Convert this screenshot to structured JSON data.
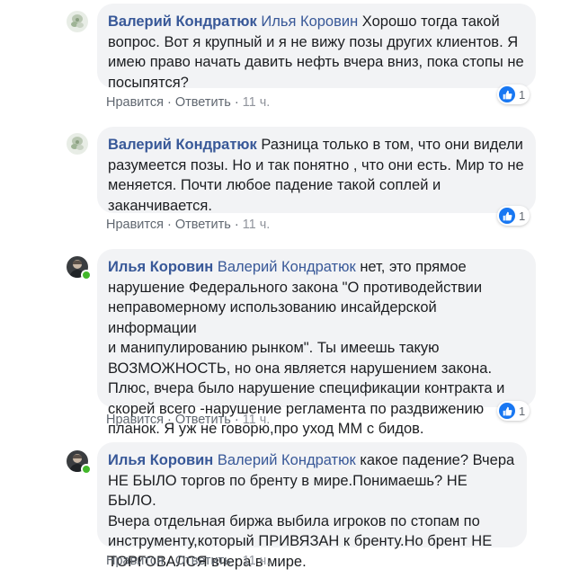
{
  "colors": {
    "link": "#385898",
    "bubble_bg": "#f2f3f5",
    "like_blue": "#1877f2",
    "online_green": "#42b72a",
    "meta_gray": "#606770"
  },
  "comments": [
    {
      "avatar_icon": "flower-avatar-icon",
      "author": "Валерий Кондратюк",
      "mention": "Илья Коровин",
      "text_lines": [
        "Хорошо тогда такой",
        "вопрос. Вот я крупный и я не вижу позы других клиентов. Я",
        "имею право начать давить нефть вчера вниз, пока стопы не",
        "посыпятся?"
      ],
      "reactions": "1",
      "like": "Нравится",
      "reply": "Ответить",
      "time": "11 ч."
    },
    {
      "avatar_icon": "flower-avatar-icon",
      "author": "Валерий Кондратюк",
      "mention": "",
      "text_lines": [
        "Разница только в том, что они видели",
        "разумеется позы. Но и так понятно , что они есть. Мир то не",
        "меняется. Почти любое падение такой соплей и",
        "заканчивается."
      ],
      "reactions": "1",
      "like": "Нравится",
      "reply": "Ответить",
      "time": "11 ч."
    },
    {
      "avatar_icon": "person-avatar-icon",
      "author": "Илья Коровин",
      "mention": "Валерий Кондратюк",
      "text_lines": [
        "нет, это прямое",
        "нарушение Федерального закона \"О противодействии",
        "неправомерному использованию инсайдерской информации",
        "и манипулированию рынком\". Ты имеешь такую",
        "ВОЗМОЖНОСТЬ, но она является нарушением закона.",
        "Плюс, вчера было нарушение спецификации контракта и",
        "скорей всего -нарушение регламента по раздвижению",
        "планок. Я уж не говорю,про уход ММ с бидов."
      ],
      "reactions": "1",
      "like": "Нравится",
      "reply": "Ответить",
      "time": "11 ч."
    },
    {
      "avatar_icon": "person-avatar-icon",
      "author": "Илья Коровин",
      "mention": "Валерий Кондратюк",
      "text_lines": [
        "какое падение? Вчера",
        "НЕ БЫЛО торгов по бренту в мире.Понимаешь? НЕ БЫЛО.",
        "Вчера отдельная биржа выбила игроков по стопам по",
        "инструменту,который ПРИВЯЗАН к бренту.Но брент НЕ",
        "ТОРГОВАЛСЯ вчера в мире."
      ],
      "reactions": "",
      "like": "Нравится",
      "reply": "Ответить",
      "time": "11 ч."
    }
  ]
}
